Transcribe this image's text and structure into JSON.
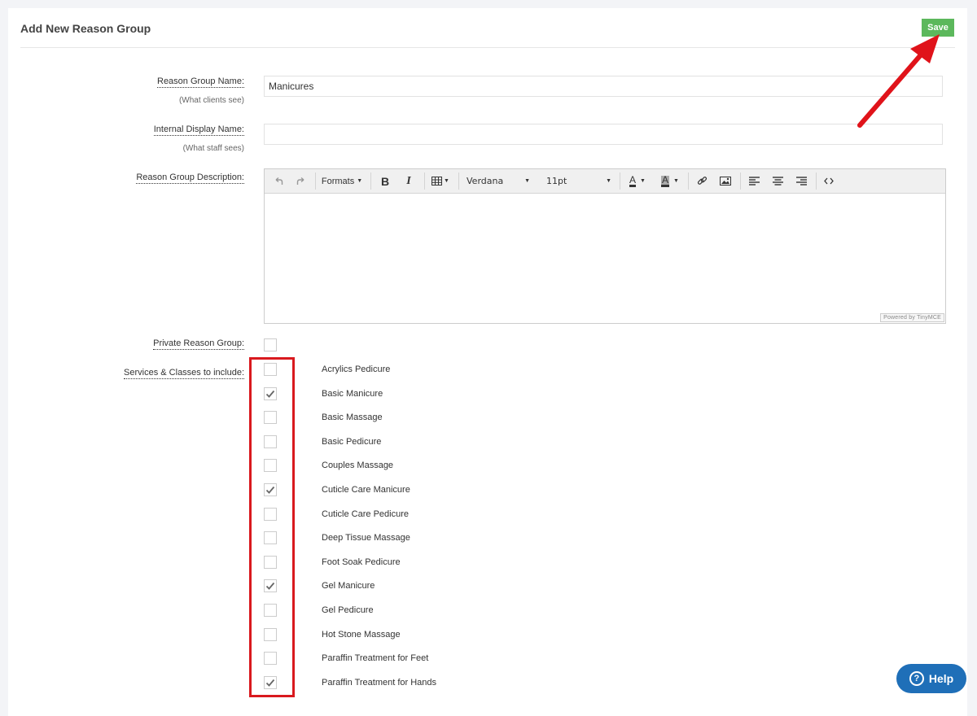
{
  "page": {
    "title": "Add New Reason Group"
  },
  "toolbar": {
    "save_label": "Save"
  },
  "fields": {
    "reason_group_name": {
      "label": "Reason Group Name:",
      "hint": "(What clients see)",
      "value": "Manicures"
    },
    "internal_display_name": {
      "label": "Internal Display Name:",
      "hint": "(What staff sees)",
      "value": ""
    },
    "description": {
      "label": "Reason Group Description:"
    },
    "private": {
      "label": "Private Reason Group:",
      "checked": false
    },
    "services": {
      "label": "Services & Classes to include:"
    }
  },
  "editor": {
    "formats_label": "Formats",
    "font_family": "Verdana",
    "font_size": "11pt",
    "powered_by": "Powered by TinyMCE",
    "icons": [
      "undo-icon",
      "redo-icon",
      "bold-icon",
      "italic-icon",
      "table-icon",
      "text-color-icon",
      "background-color-icon",
      "link-icon",
      "image-icon",
      "align-left-icon",
      "align-center-icon",
      "align-right-icon",
      "source-code-icon"
    ]
  },
  "services": [
    {
      "name": "Acrylics Pedicure",
      "checked": false
    },
    {
      "name": "Basic Manicure",
      "checked": true
    },
    {
      "name": "Basic Massage",
      "checked": false
    },
    {
      "name": "Basic Pedicure",
      "checked": false
    },
    {
      "name": "Couples Massage",
      "checked": false
    },
    {
      "name": "Cuticle Care Manicure",
      "checked": true
    },
    {
      "name": "Cuticle Care Pedicure",
      "checked": false
    },
    {
      "name": "Deep Tissue Massage",
      "checked": false
    },
    {
      "name": "Foot Soak Pedicure",
      "checked": false
    },
    {
      "name": "Gel Manicure",
      "checked": true
    },
    {
      "name": "Gel Pedicure",
      "checked": false
    },
    {
      "name": "Hot Stone Massage",
      "checked": false
    },
    {
      "name": "Paraffin Treatment for Feet",
      "checked": false
    },
    {
      "name": "Paraffin Treatment for Hands",
      "checked": true
    }
  ],
  "help": {
    "label": "Help"
  },
  "colors": {
    "save": "#5cb85c",
    "annotation": "#d9191e",
    "help": "#1f6fb8"
  }
}
